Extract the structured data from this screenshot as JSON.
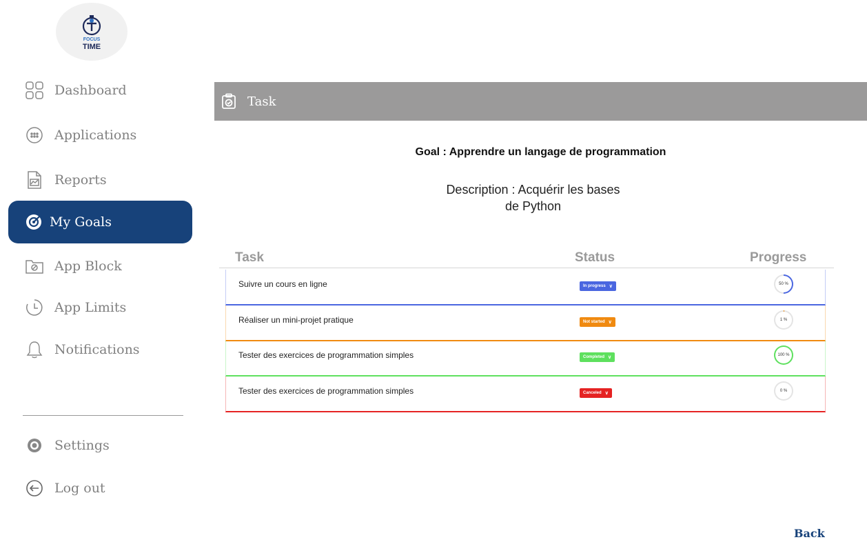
{
  "logo": {
    "line1": "FOCUS",
    "line2": "TIME"
  },
  "sidebar": {
    "items": [
      {
        "label": "Dashboard",
        "icon": "dashboard-grid-icon"
      },
      {
        "label": "Applications",
        "icon": "applications-icon"
      },
      {
        "label": "Reports",
        "icon": "reports-icon"
      },
      {
        "label": "My Goals",
        "icon": "target-icon",
        "active": true
      },
      {
        "label": "App Block",
        "icon": "app-block-icon"
      },
      {
        "label": "App Limits",
        "icon": "clock-icon"
      },
      {
        "label": "Notifications",
        "icon": "bell-icon"
      }
    ],
    "bottom": [
      {
        "label": "Settings",
        "icon": "gear-icon"
      },
      {
        "label": "Log out",
        "icon": "logout-icon"
      }
    ]
  },
  "header": {
    "title": "Task",
    "icon": "clipboard-check-icon"
  },
  "goal": "Goal : Apprendre un langage de programmation",
  "description_line1": "Description : Acquérir les bases",
  "description_line2": "de Python",
  "table": {
    "columns": [
      "Task",
      "Status",
      "Progress"
    ],
    "rows": [
      {
        "task": "Suivre un cours en ligne",
        "status": "In progress",
        "progress_text": "50 %",
        "progress": 50,
        "color": "#4a66e0"
      },
      {
        "task": "Réaliser un mini-projet pratique",
        "status": "Not started",
        "progress_text": "1 %",
        "progress": 1,
        "color": "#f08a10"
      },
      {
        "task": "Tester des exercices de programmation simples",
        "status": "Completed",
        "progress_text": "100 %",
        "progress": 100,
        "color": "#5ee05e"
      },
      {
        "task": "Tester des exercices de programmation simples",
        "status": "Canceled",
        "progress_text": "0 %",
        "progress": 0,
        "color": "#e52222"
      }
    ]
  },
  "back_label": "Back",
  "colors": {
    "accent": "#17427a",
    "header_bar": "#9b9a9a"
  }
}
